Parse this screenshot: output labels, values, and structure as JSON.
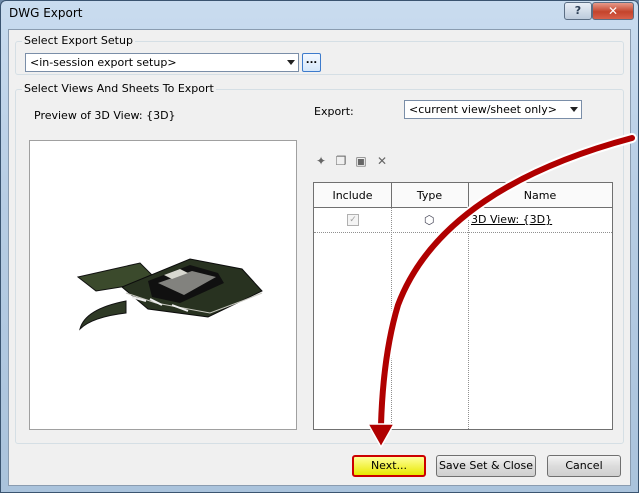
{
  "window": {
    "title": "DWG Export",
    "help_label": "?",
    "close_label": "✕"
  },
  "export_setup": {
    "group_label": "Select Export Setup",
    "selected": "<in-session export setup>",
    "browse_label": "..."
  },
  "views": {
    "group_label": "Select Views And Sheets To Export",
    "preview_label": "Preview of 3D View: {3D}",
    "export_label": "Export:",
    "export_selected": "<current view/sheet only>"
  },
  "table": {
    "headers": [
      "Include",
      "Type",
      "Name"
    ],
    "rows": [
      {
        "include": "✓",
        "type_icon": "3d-view-icon",
        "name": "3D View: {3D}"
      }
    ]
  },
  "toolbar_icons": [
    "new-set-icon",
    "duplicate-set-icon",
    "rename-set-icon",
    "delete-set-icon"
  ],
  "buttons": {
    "next": "Next...",
    "save_close": "Save Set & Close",
    "cancel": "Cancel"
  },
  "colors": {
    "annotation_arrow": "#b00000",
    "highlight": "#e8e800"
  }
}
